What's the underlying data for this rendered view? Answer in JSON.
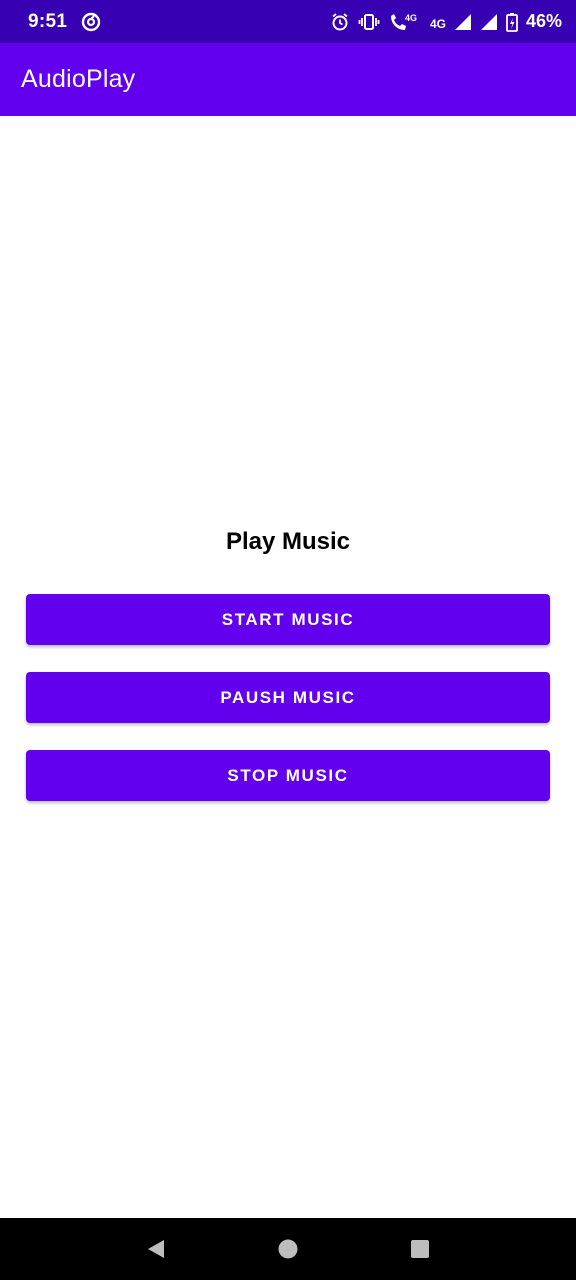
{
  "status_bar": {
    "time": "9:51",
    "battery_percent": "46%",
    "network_label": "4G",
    "icons": [
      "sync-circle-icon",
      "alarm-icon",
      "vibrate-icon",
      "volte-call-icon",
      "signal-icon",
      "signal-icon",
      "battery-charging-icon"
    ]
  },
  "app_bar": {
    "title": "AudioPlay",
    "color": "#6200ee"
  },
  "main": {
    "heading": "Play Music",
    "buttons": {
      "start": "START MUSIC",
      "pause": "PAUSH MUSIC",
      "stop": "STOP MUSIC"
    }
  },
  "nav_bar": {
    "icons": [
      "back-icon",
      "home-icon",
      "recents-icon"
    ]
  },
  "colors": {
    "status_bar": "#3700b3",
    "primary": "#6200ee",
    "background": "#ffffff"
  }
}
